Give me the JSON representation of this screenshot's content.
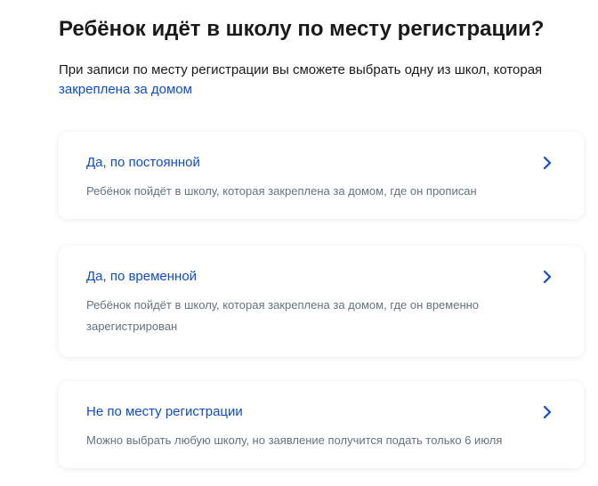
{
  "header": {
    "title": "Ребёнок идёт в школу по месту регистрации?"
  },
  "intro": {
    "text_line1": "При записи по месту регистрации вы сможете выбрать одну из школ, которая",
    "link": "закреплена за домом"
  },
  "options": [
    {
      "title": "Да, по постоянной",
      "description_lines": [
        "Ребёнок пойдёт в школу, которая закреплена за домом, где он прописан"
      ],
      "icon": "chevron-right-icon"
    },
    {
      "title": "Да, по временной",
      "description_lines": [
        "Ребёнок пойдёт в школу, которая закреплена за домом, где он временно",
        "зарегистрирован"
      ],
      "icon": "chevron-right-icon"
    },
    {
      "title": "Не по месту регистрации",
      "description_lines": [
        "Можно выбрать любую школу, но заявление получится подать только 6 июля"
      ],
      "icon": "chevron-right-icon"
    }
  ],
  "colors": {
    "accent": "#0d4cd3",
    "text": "#1a1a1a",
    "muted": "#66727f"
  }
}
